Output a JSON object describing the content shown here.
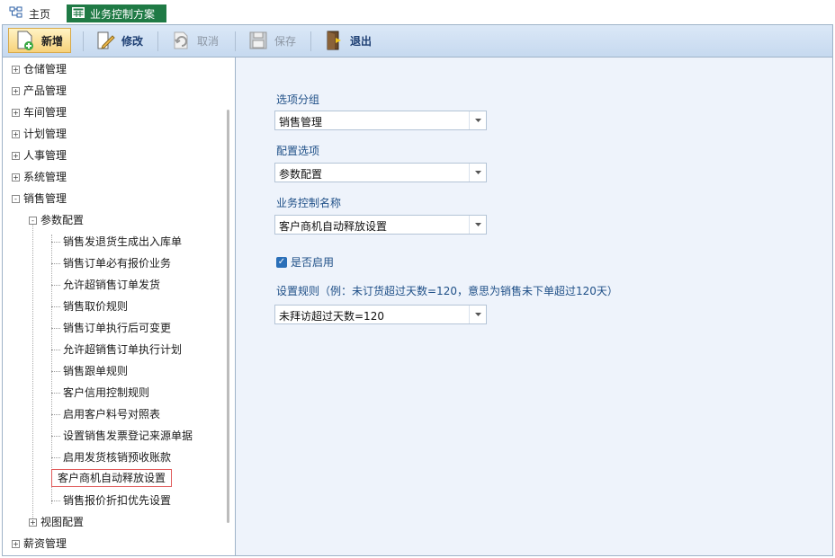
{
  "tabs": [
    {
      "label": "主页",
      "icon": "home-org-icon"
    },
    {
      "label": "业务控制方案",
      "icon": "table-icon"
    }
  ],
  "toolbar": {
    "new_label": "新增",
    "edit_label": "修改",
    "cancel_label": "取消",
    "save_label": "保存",
    "exit_label": "退出"
  },
  "tree": {
    "top_items": [
      {
        "label": "仓储管理",
        "toggle": "+"
      },
      {
        "label": "产品管理",
        "toggle": "+"
      },
      {
        "label": "车间管理",
        "toggle": "+"
      },
      {
        "label": "计划管理",
        "toggle": "+"
      },
      {
        "label": "人事管理",
        "toggle": "+"
      },
      {
        "label": "系统管理",
        "toggle": "+"
      },
      {
        "label": "销售管理",
        "toggle": "-"
      }
    ],
    "group_param": {
      "label": "参数配置",
      "toggle": "-"
    },
    "leaves": [
      "销售发退货生成出入库单",
      "销售订单必有报价业务",
      "允许超销售订单发货",
      "销售取价规则",
      "销售订单执行后可变更",
      "允许超销售订单执行计划",
      "销售跟单规则",
      "客户信用控制规则",
      "启用客户料号对照表",
      "设置销售发票登记来源单据",
      "启用发货核销预收账款",
      "客户商机自动释放设置",
      "销售报价折扣优先设置"
    ],
    "selected_index": 11,
    "group_view": {
      "label": "视图配置",
      "toggle": "+"
    },
    "salary": {
      "label": "薪资管理",
      "toggle": "+"
    }
  },
  "form": {
    "group_label": "选项分组",
    "group_value": "销售管理",
    "config_label": "配置选项",
    "config_value": "参数配置",
    "name_label": "业务控制名称",
    "name_value": "客户商机自动释放设置",
    "enabled_label": "是否启用",
    "enabled": true,
    "rule_label": "设置规则（例：未订货超过天数=120，意思为销售未下单超过120天）",
    "rule_value": "未拜访超过天数=120"
  },
  "colors": {
    "accent": "#1f7a45",
    "toolbar": "#c6d9ef",
    "label": "#1e4f87",
    "checkbox": "#2a6fb8",
    "content_bg": "#eef3fb"
  }
}
